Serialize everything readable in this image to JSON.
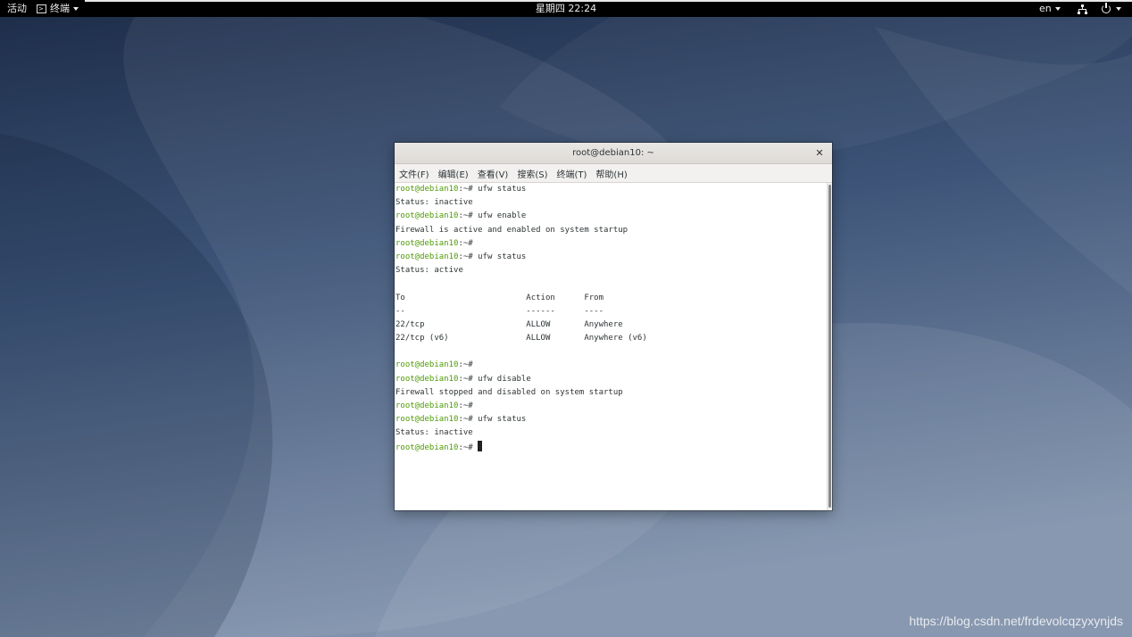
{
  "colors": {
    "desktop_dark": "#1e2f4d",
    "desktop_light": "#7e8fa9",
    "topbar": "#000000",
    "prompt_green": "#4e9a06",
    "terminal_text": "#2e3436"
  },
  "topbar": {
    "activities": "活动",
    "app_icon": "terminal-icon",
    "app_name": "终端",
    "clock": "星期四 22:24",
    "language": "en",
    "network_icon": "network-icon",
    "power_icon": "power-icon"
  },
  "window": {
    "title": "root@debian10: ~",
    "close_icon": "close-icon",
    "menu": [
      "文件(F)",
      "编辑(E)",
      "查看(V)",
      "搜索(S)",
      "终端(T)",
      "帮助(H)"
    ]
  },
  "terminal": {
    "prompt": "root@debian10",
    "prompt_suffix": ":~#",
    "lines": [
      {
        "p": true,
        "t": " ufw status"
      },
      {
        "p": false,
        "t": "Status: inactive"
      },
      {
        "p": true,
        "t": " ufw enable"
      },
      {
        "p": false,
        "t": "Firewall is active and enabled on system startup"
      },
      {
        "p": true,
        "t": ""
      },
      {
        "p": true,
        "t": " ufw status"
      },
      {
        "p": false,
        "t": "Status: active"
      },
      {
        "p": false,
        "t": ""
      },
      {
        "p": false,
        "t": "To                         Action      From"
      },
      {
        "p": false,
        "t": "--                         ------      ----"
      },
      {
        "p": false,
        "t": "22/tcp                     ALLOW       Anywhere"
      },
      {
        "p": false,
        "t": "22/tcp (v6)                ALLOW       Anywhere (v6)"
      },
      {
        "p": false,
        "t": ""
      },
      {
        "p": true,
        "t": ""
      },
      {
        "p": true,
        "t": " ufw disable"
      },
      {
        "p": false,
        "t": "Firewall stopped and disabled on system startup"
      },
      {
        "p": true,
        "t": ""
      },
      {
        "p": true,
        "t": " ufw status"
      },
      {
        "p": false,
        "t": "Status: inactive"
      },
      {
        "p": true,
        "t": " ",
        "cursor": true
      }
    ]
  },
  "watermark": "https://blog.csdn.net/frdevolcqzyxynjds"
}
